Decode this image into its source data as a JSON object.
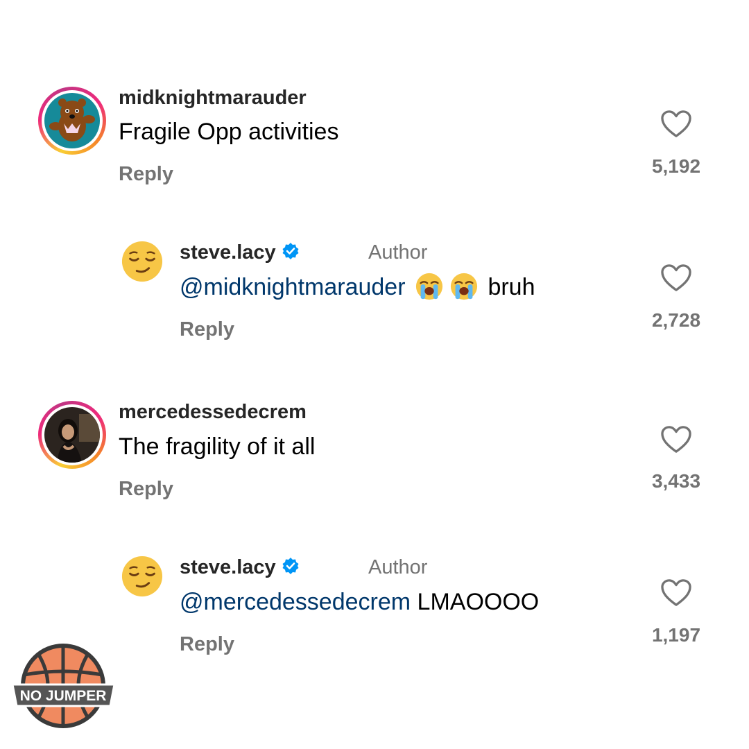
{
  "comments": [
    {
      "username": "midknightmarauder",
      "text": "Fragile Opp activities",
      "reply_label": "Reply",
      "like_count": "5,192",
      "avatar": "dancing-bear-avatar"
    },
    {
      "username": "steve.lacy",
      "verified": true,
      "author_badge": "Author",
      "mention": "@midknightmarauder",
      "text_after": "bruh",
      "emojis": [
        "loudly-crying-face",
        "loudly-crying-face"
      ],
      "reply_label": "Reply",
      "like_count": "2,728",
      "avatar": "relieved-face-emoji-avatar"
    },
    {
      "username": "mercedessedecrem",
      "text": "The fragility of it all",
      "reply_label": "Reply",
      "like_count": "3,433",
      "avatar": "photo-avatar"
    },
    {
      "username": "steve.lacy",
      "verified": true,
      "author_badge": "Author",
      "mention": "@mercedessedecrem",
      "text_after": "LMAOOOO",
      "reply_label": "Reply",
      "like_count": "1,197",
      "avatar": "relieved-face-emoji-avatar"
    }
  ],
  "watermark": {
    "text": "NO JUMPER",
    "icon": "basketball-logo"
  },
  "colors": {
    "mention": "#00376b",
    "secondary_text": "#737373",
    "verified": "#0095f6",
    "logo_orange": "#f08a60"
  }
}
